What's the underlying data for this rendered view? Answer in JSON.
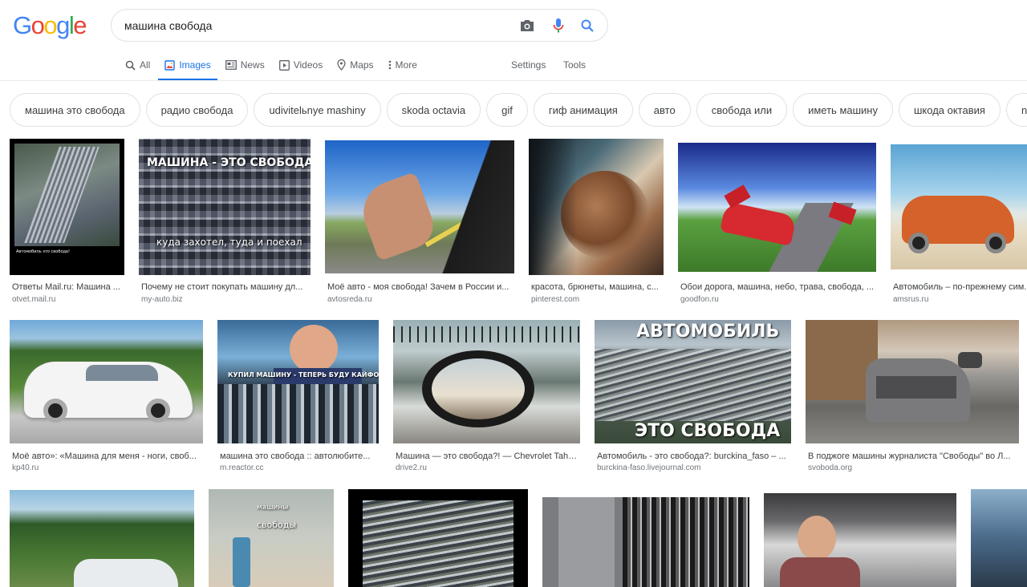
{
  "logo": {
    "letters": [
      "G",
      "o",
      "o",
      "g",
      "l",
      "e"
    ],
    "colors": [
      "#4285F4",
      "#EA4335",
      "#FBBC05",
      "#4285F4",
      "#34A853",
      "#EA4335"
    ]
  },
  "search": {
    "value": "машина свобода"
  },
  "tabs": [
    {
      "label": "All",
      "icon": "search-icon"
    },
    {
      "label": "Images",
      "icon": "image-icon",
      "active": true
    },
    {
      "label": "News",
      "icon": "news-icon"
    },
    {
      "label": "Videos",
      "icon": "video-icon"
    },
    {
      "label": "Maps",
      "icon": "map-pin-icon"
    },
    {
      "label": "More",
      "icon": "more-icon"
    }
  ],
  "settings_label": "Settings",
  "tools_label": "Tools",
  "chips": [
    "машина это свобода",
    "радио свобода",
    "udivitelьnye mashiny",
    "skoda octavia",
    "gif",
    "гиф анимация",
    "авто",
    "свобода или",
    "иметь машину",
    "шкода октавия",
    "novo"
  ],
  "results": [
    {
      "caption": "Ответы Mail.ru: Машина ...",
      "source": "otvet.mail.ru",
      "overlay": "",
      "footnote": "Автомобиль это свобода!"
    },
    {
      "caption": "Почему не стоит покупать машину дл...",
      "source": "my-auto.biz",
      "overlay": "МАШИНА - ЭТО СВОБОДА!",
      "overlay2": "куда захотел, туда и поехал"
    },
    {
      "caption": "Моё авто - моя свобода! Зачем в России и...",
      "source": "avtosreda.ru"
    },
    {
      "caption": "красота, брюнеты, машина, с...",
      "source": "pinterest.com"
    },
    {
      "caption": "Обои дорога, машина, небо, трава, свобода, ...",
      "source": "goodfon.ru"
    },
    {
      "caption": "Автомобиль – по-прежнему сим...",
      "source": "amsrus.ru"
    },
    {
      "caption": "Моё авто»: «Машина для меня - ноги, своб...",
      "source": "kp40.ru"
    },
    {
      "caption": "машина это свобода :: автолюбите...",
      "source": "m.reactor.cc",
      "overlay": "КУПИЛ МАШИНУ - ТЕПЕРЬ БУДУ КАЙФОВАТЬ"
    },
    {
      "caption": "Машина — это свобода?! — Chevrolet Taho...",
      "source": "drive2.ru"
    },
    {
      "caption": "Автомобиль - это свобода?: burckina_faso – ...",
      "source": "burckina-faso.livejournal.com",
      "overlay": "АВТОМОБИЛЬ",
      "overlay2": "ЭТО СВОБОДА"
    },
    {
      "caption": "В поджоге машины журналиста \"Свободы\" во Л...",
      "source": "svoboda.org"
    },
    {
      "caption": "",
      "source": ""
    },
    {
      "caption": "",
      "source": "",
      "overlay": "машины",
      "overlay2": "свободы"
    },
    {
      "caption": "",
      "source": ""
    },
    {
      "caption": "",
      "source": ""
    },
    {
      "caption": "",
      "source": ""
    },
    {
      "caption": "",
      "source": ""
    }
  ]
}
